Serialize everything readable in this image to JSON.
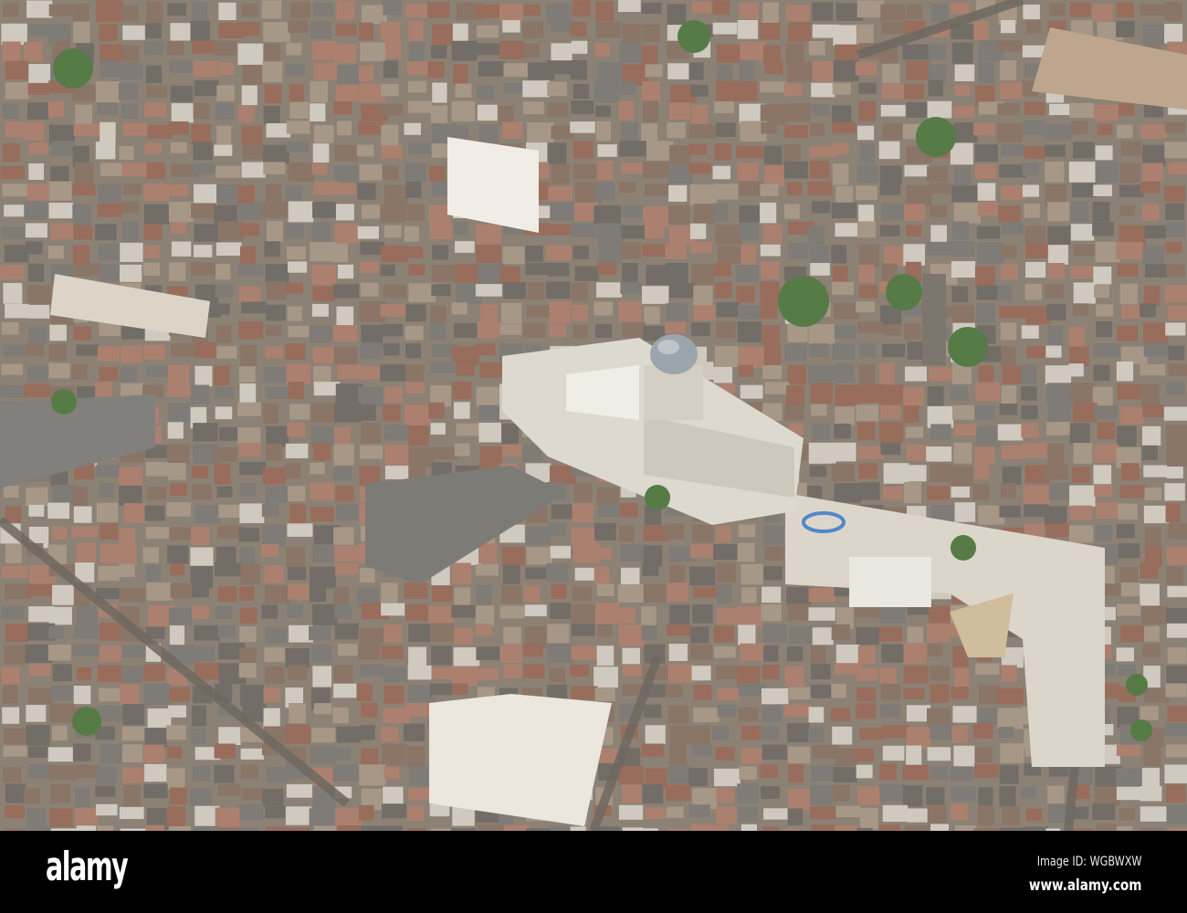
{
  "photo": {
    "subject": "aerial view of city centre with domed council house and market square",
    "colors": {
      "roof_brick": "#8a5a4a",
      "roof_slate": "#6e6a68",
      "roof_light": "#c9c3bb",
      "tree": "#3f6a33",
      "plaza": "#d8d2c8",
      "street": "#5a5550"
    }
  },
  "watermark": {
    "logo": "alamy",
    "image_id": "Image ID: WGBWXW",
    "url": "www.alamy.com"
  }
}
